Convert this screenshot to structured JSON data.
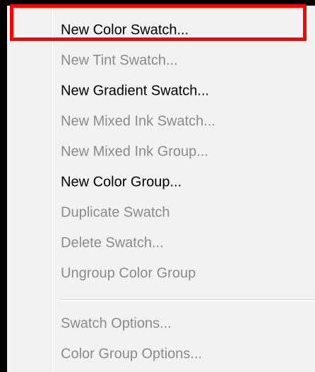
{
  "menu": {
    "items": [
      {
        "label": "New Color Swatch...",
        "enabled": true
      },
      {
        "label": "New Tint Swatch...",
        "enabled": false
      },
      {
        "label": "New Gradient Swatch...",
        "enabled": true
      },
      {
        "label": "New Mixed Ink Swatch...",
        "enabled": false
      },
      {
        "label": "New Mixed Ink Group...",
        "enabled": false
      },
      {
        "label": "New Color Group...",
        "enabled": true
      },
      {
        "label": "Duplicate Swatch",
        "enabled": false
      },
      {
        "label": "Delete Swatch...",
        "enabled": false
      },
      {
        "label": "Ungroup Color Group",
        "enabled": false
      },
      {
        "label": "Swatch Options...",
        "enabled": false
      },
      {
        "label": "Color Group Options...",
        "enabled": false
      }
    ],
    "highlighted_item": "New Color Swatch...",
    "colors": {
      "background": "#f2f2f2",
      "enabled_text": "#000000",
      "disabled_text": "#8a8a8a",
      "highlight_border": "#ff0000",
      "frame": "#000000"
    }
  }
}
